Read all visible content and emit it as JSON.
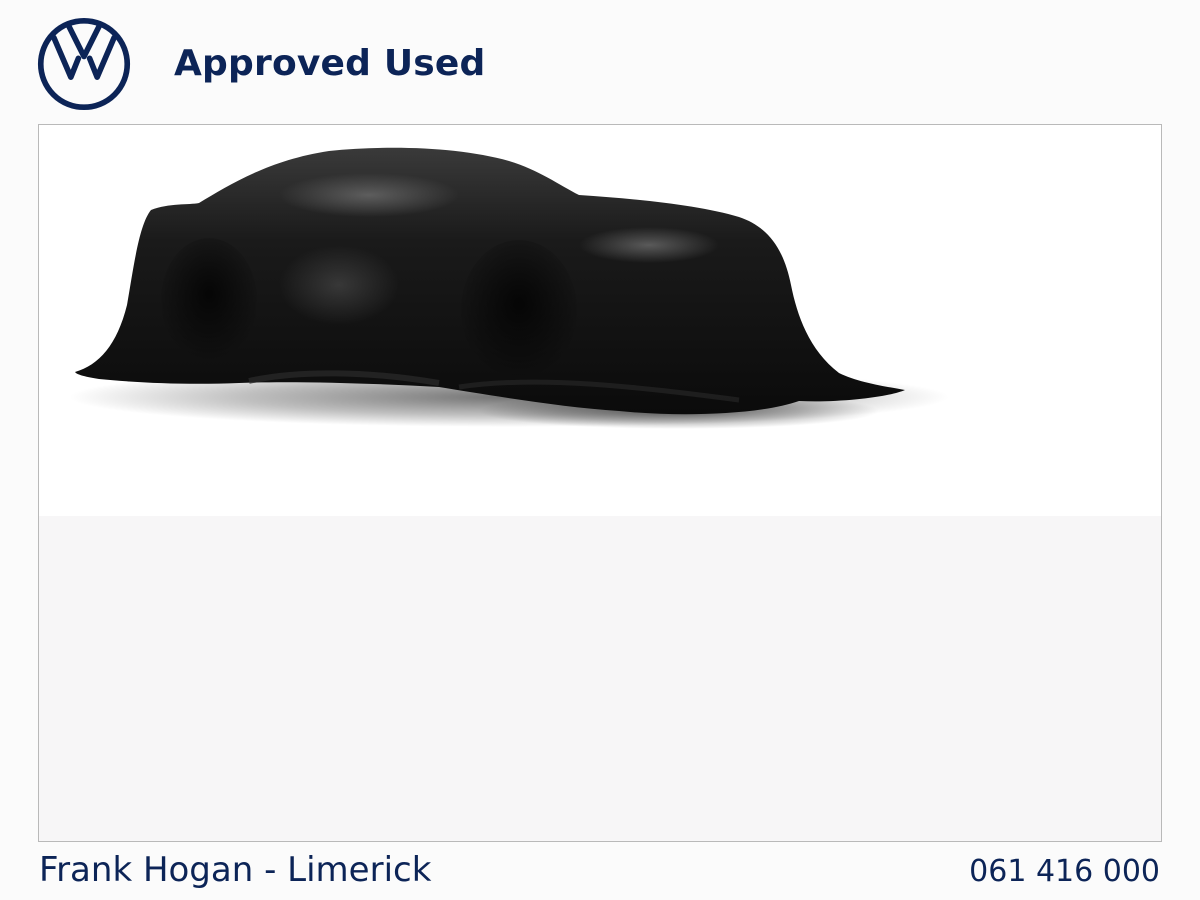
{
  "header": {
    "logo_icon": "vw-logo-icon",
    "title": "Approved Used"
  },
  "main": {
    "image_subject": "covered-car-placeholder"
  },
  "footer": {
    "dealer": "Frank Hogan - Limerick",
    "phone": "061 416 000"
  },
  "colors": {
    "brand_navy": "#0c2457",
    "frame_border": "#b9b9b9",
    "background": "#fbfbfb"
  }
}
